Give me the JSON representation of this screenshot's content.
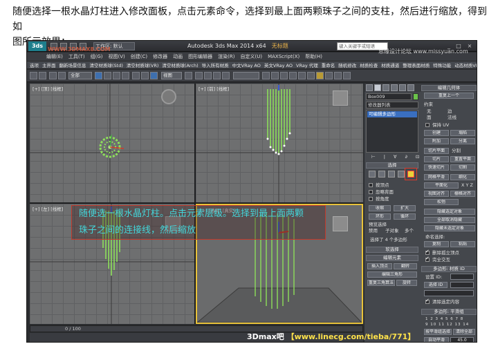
{
  "instruction": {
    "line1": "随便选择一根水晶灯柱进入修改面板，点击元素命令，选择到最上面两颗珠子之间的支柱，然后进行缩放，得到如",
    "line2": "图所示效果："
  },
  "titlebar": {
    "workspace": "工作区: 默认",
    "app_title": "Autodesk 3ds Max  2014 x64",
    "doc_title": "无标题",
    "search_placeholder": "键入关键字或短语",
    "min": "_",
    "max": "□",
    "close": "×"
  },
  "menubar": [
    "编辑(E)",
    "工具(T)",
    "组(G)",
    "视图(V)",
    "创建(C)",
    "修改器",
    "动画",
    "图形编辑器",
    "渲染(R)",
    "自定义(U)",
    "MAXScript(X)",
    "帮助(H)"
  ],
  "tabstrip": [
    "选项",
    "主界面",
    "翻新场景信息",
    "清空材质球(Std)",
    "清空材质球(VR)",
    "清空材质球(Arch)",
    "导入所有材质",
    "中文VRay AO",
    "英文VRay AO",
    "VRay 代理",
    "重命名",
    "随机修改",
    "材质检查",
    "材质通道",
    "整理表面材质",
    "特殊功能",
    "动态材质VRayHill"
  ],
  "toolbar": {
    "filter_select": "全部",
    "refcoord_select": "视图"
  },
  "viewports": {
    "top": "[+] [顶] [线框]",
    "front": "[+] [前] [线框]",
    "left": "[+] [左] [线框]",
    "perspective": "[+] [透视] [真实]"
  },
  "annotation": {
    "line1": "随便选一根水晶灯柱。点击元素层级。选择到最上面两颗",
    "line2": "珠子之间的连接线，然后缩放"
  },
  "command_panel": {
    "object_name": "Box009",
    "modifier_list": "修改器列表",
    "stack_item": "可编辑多边形",
    "edit_geom": "编辑几何体",
    "repeat_last": "重复上一个",
    "constraint": "约束",
    "c_none": "无",
    "c_edge": "边",
    "c_face": "面",
    "c_normal": "法线",
    "preserve_uv": "保持 UV",
    "create": "创建",
    "collapse": "塌陷",
    "attach": "附加",
    "detach": "分离",
    "slice_plane": "切片平面",
    "split": "分割",
    "slice": "切片",
    "reset_plane": "重置平面",
    "quickslice": "快速切片",
    "cut": "切割",
    "meshsmooth": "网格平滑",
    "tessellate": "细化",
    "make_planar": "平面化",
    "view_align": "视图对齐",
    "grid_align": "栅格对齐",
    "relax": "松弛",
    "hide_selected": "隐藏选定对象",
    "unhide_all": "全部取消隐藏",
    "hide_unselected": "隐藏未选定对象",
    "named_sel": "命名选择:",
    "copy": "复制",
    "paste": "粘贴",
    "delete_iso": "删除孤立顶点",
    "full_interactivity": "完全交互",
    "selection": "选择",
    "by_vertex": "按顶点",
    "ignore_back": "忽略背面",
    "by_angle": "按角度",
    "shrink": "收缩",
    "grow": "扩大",
    "ring": "环形",
    "loop": "循环",
    "preview_sel": "预览选择",
    "pv_off": "禁用",
    "pv_sub": "子对象",
    "pv_multi": "多个",
    "sel_count": "选择了 4 个多边形",
    "soft_sel": "软选择",
    "edit_elements": "编辑元素",
    "insert_vertex": "插入顶点",
    "flip": "翻转",
    "edit_tri": "编辑三角形",
    "retriangulate": "重复三角算法",
    "rotate": "旋转",
    "poly_material": "多边形: 材质 ID",
    "set_id": "设置 ID:",
    "select_id": "选择 ID",
    "clear_sel": "清除选定内容",
    "smoothing_groups": "多边形: 平滑组",
    "sg_select_by": "按平滑组选择",
    "sg_clear_all": "清除全部",
    "auto_smooth": "自动平滑",
    "auto_smooth_val": "45.0"
  },
  "timeline": {
    "frame_label": "0 / 100"
  },
  "watermark": {
    "site": "3Dmax吧",
    "url": "【www.linecg.com/tieba/771】"
  },
  "watermark_top": "思缘设计论坛  www.missyuan.com",
  "watermark_topleft": "WWW.3DMAX8.COM"
}
